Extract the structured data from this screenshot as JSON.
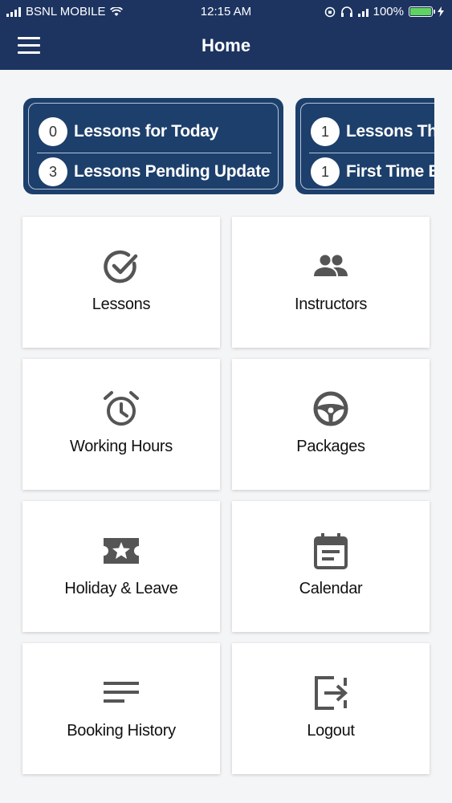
{
  "status_bar": {
    "carrier": "BSNL MOBILE",
    "time": "12:15 AM",
    "battery": "100%"
  },
  "header": {
    "title": "Home",
    "menu_icon": "hamburger-menu-icon"
  },
  "summary_cards": [
    {
      "rows": [
        {
          "count": "0",
          "label": "Lessons for Today"
        },
        {
          "count": "3",
          "label": "Lessons Pending Update"
        }
      ]
    },
    {
      "rows": [
        {
          "count": "1",
          "label": "Lessons This"
        },
        {
          "count": "1",
          "label": "First Time Bo"
        }
      ]
    }
  ],
  "tiles": [
    {
      "label": "Lessons",
      "icon": "check-circle-icon"
    },
    {
      "label": "Instructors",
      "icon": "people-icon"
    },
    {
      "label": "Working Hours",
      "icon": "alarm-clock-icon"
    },
    {
      "label": "Packages",
      "icon": "steering-wheel-icon"
    },
    {
      "label": "Holiday & Leave",
      "icon": "ticket-star-icon"
    },
    {
      "label": "Calendar",
      "icon": "calendar-icon"
    },
    {
      "label": "Booking History",
      "icon": "list-lines-icon"
    },
    {
      "label": "Logout",
      "icon": "logout-icon"
    }
  ],
  "colors": {
    "header_bg": "#1d3461",
    "card_bg": "#1d3f6b",
    "icon_color": "#555555"
  }
}
